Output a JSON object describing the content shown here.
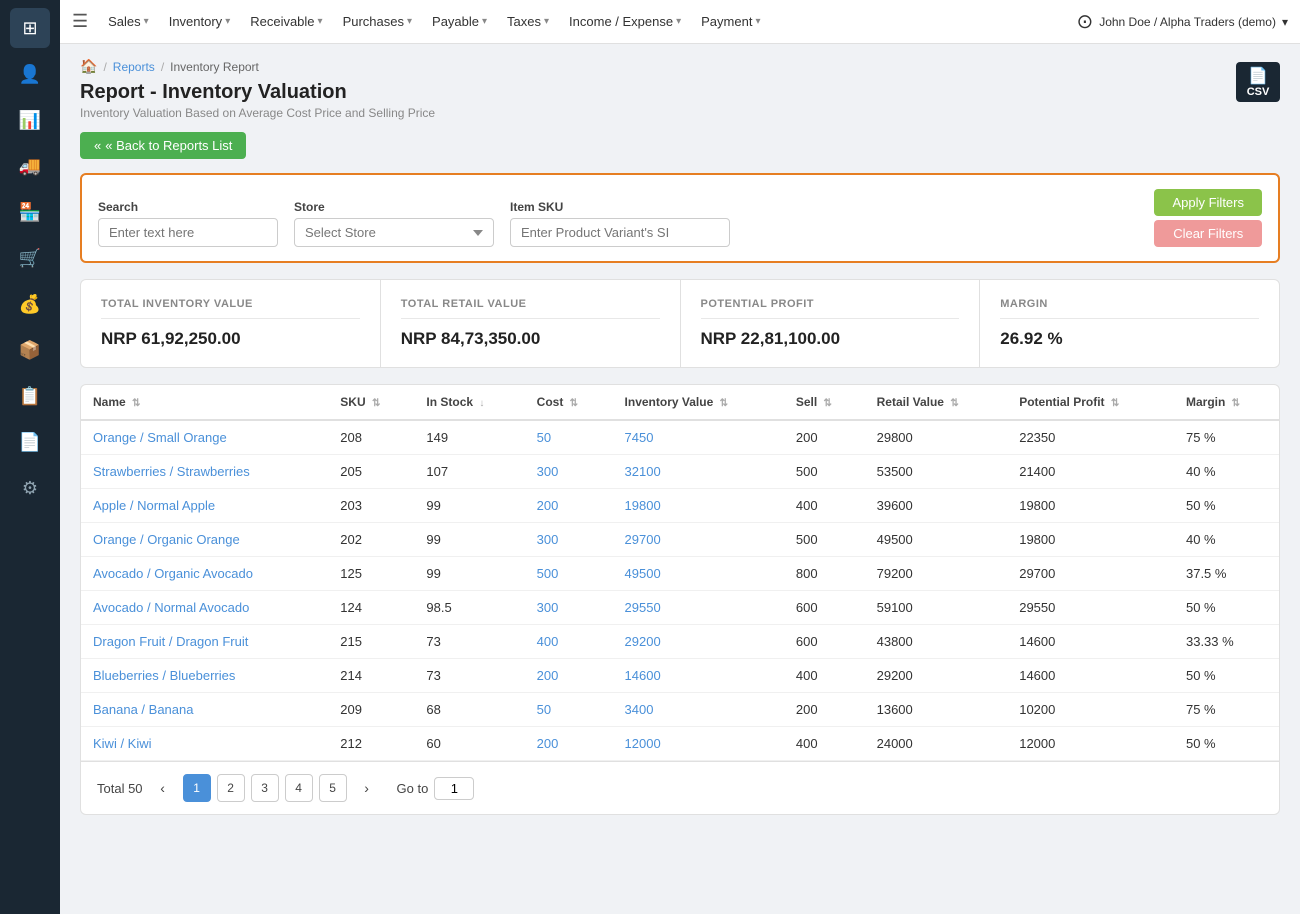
{
  "sidebar": {
    "icons": [
      {
        "name": "dashboard-icon",
        "glyph": "⊞"
      },
      {
        "name": "user-icon",
        "glyph": "👤"
      },
      {
        "name": "chart-icon",
        "glyph": "📊"
      },
      {
        "name": "truck-icon",
        "glyph": "🚚"
      },
      {
        "name": "warehouse-icon",
        "glyph": "🏪"
      },
      {
        "name": "cart-icon",
        "glyph": "🛒"
      },
      {
        "name": "person-money-icon",
        "glyph": "💰"
      },
      {
        "name": "package-icon",
        "glyph": "📦"
      },
      {
        "name": "list-icon",
        "glyph": "📋"
      },
      {
        "name": "report-icon",
        "glyph": "📄"
      },
      {
        "name": "settings-icon",
        "glyph": "⚙"
      }
    ]
  },
  "topnav": {
    "hamburger": "☰",
    "items": [
      {
        "label": "Sales",
        "id": "sales"
      },
      {
        "label": "Inventory",
        "id": "inventory"
      },
      {
        "label": "Receivable",
        "id": "receivable"
      },
      {
        "label": "Purchases",
        "id": "purchases"
      },
      {
        "label": "Payable",
        "id": "payable"
      },
      {
        "label": "Taxes",
        "id": "taxes"
      },
      {
        "label": "Income / Expense",
        "id": "income-expense"
      },
      {
        "label": "Payment",
        "id": "payment"
      }
    ],
    "user": "John Doe / Alpha Traders (demo)"
  },
  "breadcrumb": {
    "home_icon": "🏠",
    "items": [
      "Reports",
      "Inventory Report"
    ]
  },
  "page": {
    "title": "Report - Inventory Valuation",
    "subtitle": "Inventory Valuation Based on Average Cost Price and Selling Price"
  },
  "back_button": "« Back to Reports List",
  "csv_button": "CSV",
  "filters": {
    "search_label": "Search",
    "search_placeholder": "Enter text here",
    "store_label": "Store",
    "store_placeholder": "Select Store",
    "sku_label": "Item SKU",
    "sku_placeholder": "Enter Product Variant's SI",
    "apply_label": "Apply Filters",
    "clear_label": "Clear Filters"
  },
  "summary": {
    "cards": [
      {
        "title": "TOTAL INVENTORY VALUE",
        "value": "NRP 61,92,250.00"
      },
      {
        "title": "TOTAL RETAIL VALUE",
        "value": "NRP 84,73,350.00"
      },
      {
        "title": "POTENTIAL PROFIT",
        "value": "NRP 22,81,100.00"
      },
      {
        "title": "MARGIN",
        "value": "26.92 %"
      }
    ]
  },
  "table": {
    "columns": [
      {
        "label": "Name",
        "id": "name"
      },
      {
        "label": "SKU",
        "id": "sku"
      },
      {
        "label": "In Stock",
        "id": "instock"
      },
      {
        "label": "Cost",
        "id": "cost"
      },
      {
        "label": "Inventory Value",
        "id": "inv_value"
      },
      {
        "label": "Sell",
        "id": "sell"
      },
      {
        "label": "Retail Value",
        "id": "retail_value"
      },
      {
        "label": "Potential Profit",
        "id": "potential_profit"
      },
      {
        "label": "Margin",
        "id": "margin"
      }
    ],
    "rows": [
      {
        "name": "Orange / Small Orange",
        "sku": "208",
        "instock": "149",
        "cost": "50",
        "inv_value": "7450",
        "sell": "200",
        "retail_value": "29800",
        "potential_profit": "22350",
        "margin": "75 %"
      },
      {
        "name": "Strawberries / Strawberries",
        "sku": "205",
        "instock": "107",
        "cost": "300",
        "inv_value": "32100",
        "sell": "500",
        "retail_value": "53500",
        "potential_profit": "21400",
        "margin": "40 %"
      },
      {
        "name": "Apple / Normal Apple",
        "sku": "203",
        "instock": "99",
        "cost": "200",
        "inv_value": "19800",
        "sell": "400",
        "retail_value": "39600",
        "potential_profit": "19800",
        "margin": "50 %"
      },
      {
        "name": "Orange / Organic Orange",
        "sku": "202",
        "instock": "99",
        "cost": "300",
        "inv_value": "29700",
        "sell": "500",
        "retail_value": "49500",
        "potential_profit": "19800",
        "margin": "40 %"
      },
      {
        "name": "Avocado / Organic Avocado",
        "sku": "125",
        "instock": "99",
        "cost": "500",
        "inv_value": "49500",
        "sell": "800",
        "retail_value": "79200",
        "potential_profit": "29700",
        "margin": "37.5 %"
      },
      {
        "name": "Avocado / Normal Avocado",
        "sku": "124",
        "instock": "98.5",
        "cost": "300",
        "inv_value": "29550",
        "sell": "600",
        "retail_value": "59100",
        "potential_profit": "29550",
        "margin": "50 %"
      },
      {
        "name": "Dragon Fruit / Dragon Fruit",
        "sku": "215",
        "instock": "73",
        "cost": "400",
        "inv_value": "29200",
        "sell": "600",
        "retail_value": "43800",
        "potential_profit": "14600",
        "margin": "33.33 %"
      },
      {
        "name": "Blueberries / Blueberries",
        "sku": "214",
        "instock": "73",
        "cost": "200",
        "inv_value": "14600",
        "sell": "400",
        "retail_value": "29200",
        "potential_profit": "14600",
        "margin": "50 %"
      },
      {
        "name": "Banana / Banana",
        "sku": "209",
        "instock": "68",
        "cost": "50",
        "inv_value": "3400",
        "sell": "200",
        "retail_value": "13600",
        "potential_profit": "10200",
        "margin": "75 %"
      },
      {
        "name": "Kiwi / Kiwi",
        "sku": "212",
        "instock": "60",
        "cost": "200",
        "inv_value": "12000",
        "sell": "400",
        "retail_value": "24000",
        "potential_profit": "12000",
        "margin": "50 %"
      }
    ]
  },
  "pagination": {
    "total_label": "Total 50",
    "pages": [
      "1",
      "2",
      "3",
      "4",
      "5"
    ],
    "active_page": "1",
    "goto_label": "Go to",
    "goto_value": "1"
  }
}
